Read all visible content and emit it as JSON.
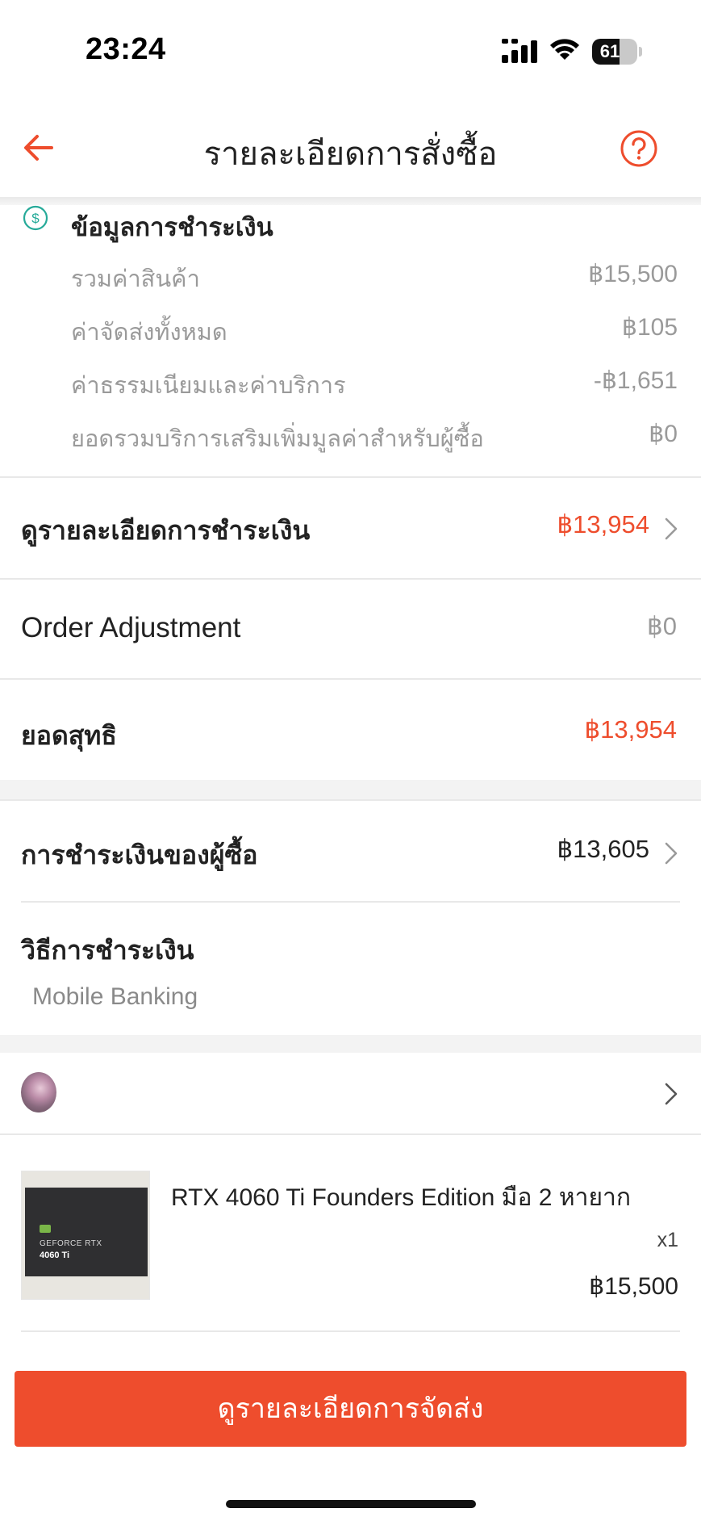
{
  "status_bar": {
    "time": "23:24",
    "battery_level": 61,
    "battery_text": "61"
  },
  "header": {
    "title": "รายละเอียดการสั่งซื้อ",
    "back_icon": "arrow-left-icon",
    "help_icon": "question-circle-icon"
  },
  "payment_info": {
    "icon": "dollar-circle-icon",
    "title": "ข้อมูลการชำระเงิน",
    "rows": [
      {
        "label": "รวมค่าสินค้า",
        "value": "฿15,500"
      },
      {
        "label": "ค่าจัดส่งทั้งหมด",
        "value": "฿105"
      },
      {
        "label": "ค่าธรรมเนียมและค่าบริการ",
        "value": "-฿1,651"
      },
      {
        "label": "ยอดรวมบริการเสริมเพิ่มมูลค่าสำหรับผู้ซื้อ",
        "value": "฿0"
      }
    ]
  },
  "view_payment_details": {
    "label": "ดูรายละเอียดการชำระเงิน",
    "value": "฿13,954"
  },
  "order_adjustment": {
    "label": "Order Adjustment",
    "value": "฿0"
  },
  "net_total": {
    "label": "ยอดสุทธิ",
    "value": "฿13,954"
  },
  "buyer_payment": {
    "label": "การชำระเงินของผู้ซื้อ",
    "value": "฿13,605"
  },
  "payment_method": {
    "label": "วิธีการชำระเงิน",
    "value": "Mobile Banking"
  },
  "product": {
    "name": "RTX 4060 Ti Founders Edition มือ 2 หายาก",
    "quantity": "x1",
    "price": "฿15,500",
    "thumb_line1": "GEFORCE RTX",
    "thumb_line2": "4060 Ti"
  },
  "bottom": {
    "cta_label": "ดูรายละเอียดการจัดส่ง"
  },
  "colors": {
    "accent": "#ee4d2d",
    "teal_icon": "#26aa99",
    "muted": "#9a9a9a"
  }
}
